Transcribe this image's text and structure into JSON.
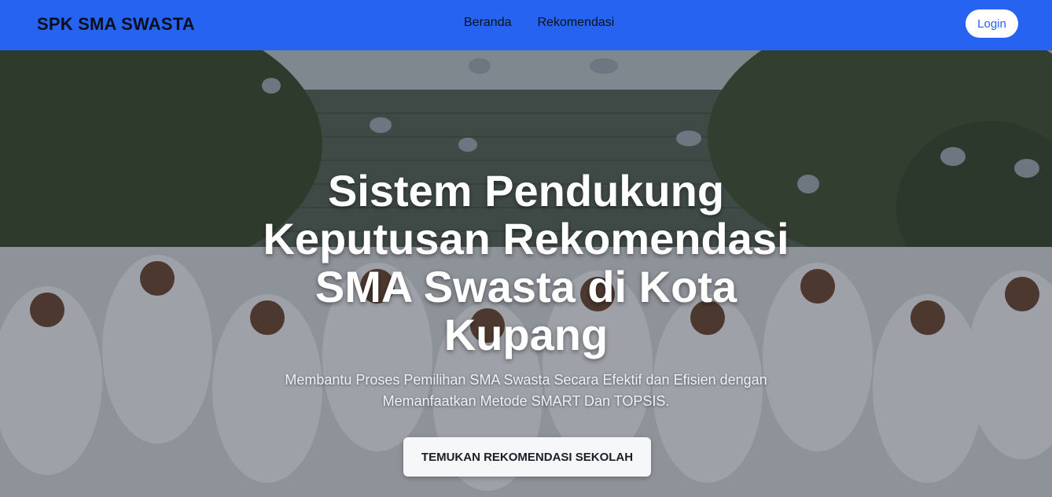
{
  "navbar": {
    "brand": "SPK SMA SWASTA",
    "links": [
      "Beranda",
      "Rekomendasi"
    ],
    "login_label": "Login",
    "bg_color": "#2563f0"
  },
  "hero": {
    "title": "Sistem Pendukung Keputusan Rekomendasi SMA Swasta di Kota Kupang",
    "subtitle": "Membantu Proses Pemilihan SMA Swasta Secara Efektif dan Efisien dengan Memanfaatkan Metode SMART Dan TOPSIS.",
    "cta_label": "TEMUKAN REKOMENDASI SEKOLAH"
  }
}
